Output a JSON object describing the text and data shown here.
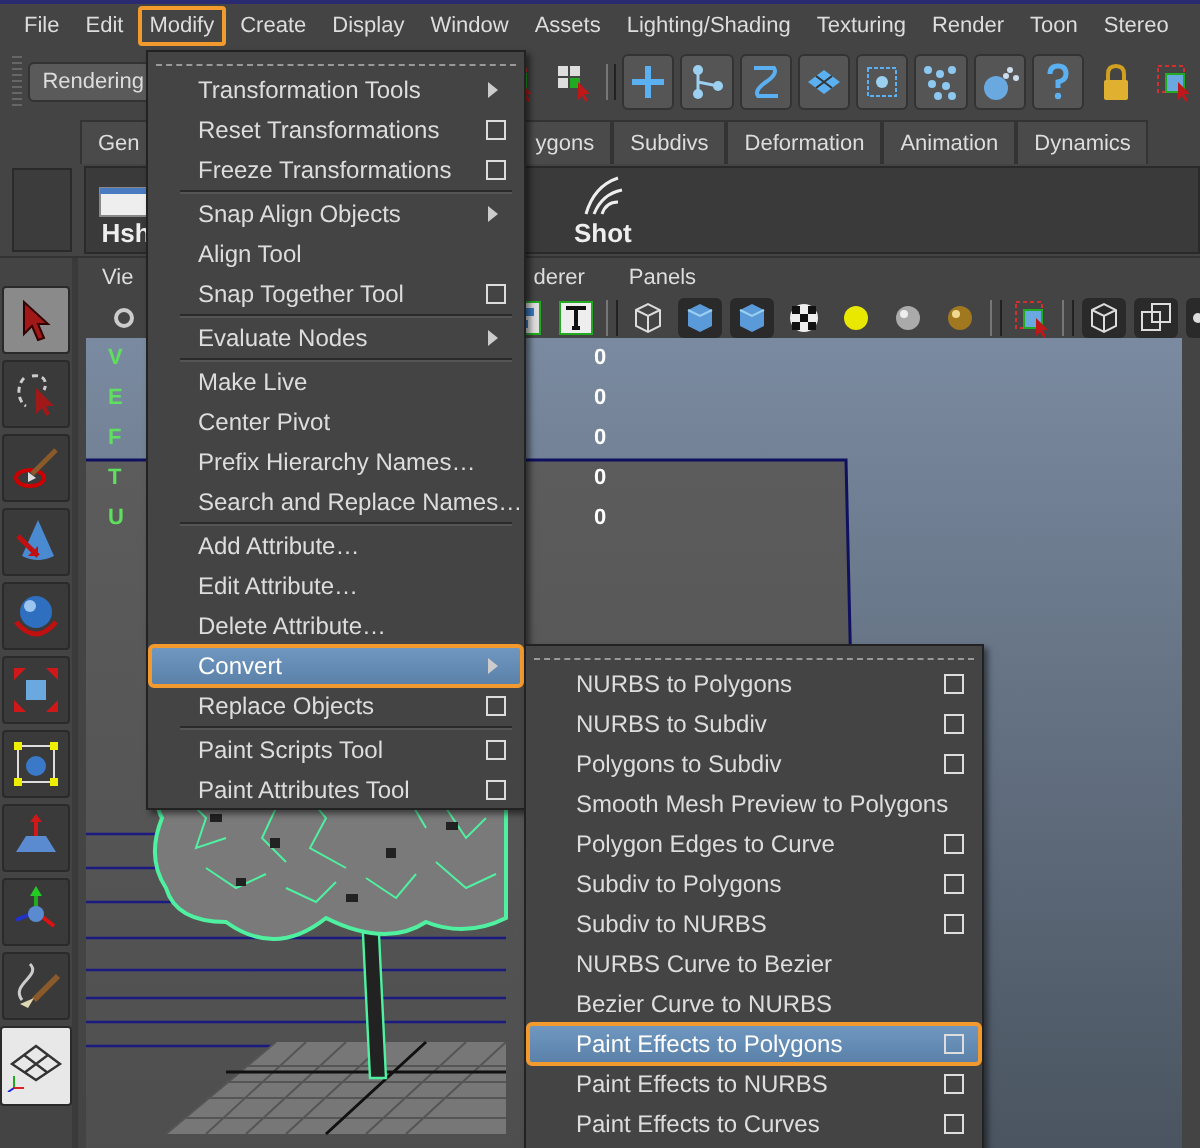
{
  "menubar": [
    {
      "label": "File",
      "selected": false
    },
    {
      "label": "Edit",
      "selected": false
    },
    {
      "label": "Modify",
      "selected": true
    },
    {
      "label": "Create",
      "selected": false
    },
    {
      "label": "Display",
      "selected": false
    },
    {
      "label": "Window",
      "selected": false
    },
    {
      "label": "Assets",
      "selected": false
    },
    {
      "label": "Lighting/Shading",
      "selected": false
    },
    {
      "label": "Texturing",
      "selected": false
    },
    {
      "label": "Render",
      "selected": false
    },
    {
      "label": "Toon",
      "selected": false
    },
    {
      "label": "Stereo",
      "selected": false
    }
  ],
  "toolbar": {
    "menu_set": "Rendering"
  },
  "shelf_tabs": [
    {
      "label": "Gen"
    },
    {
      "label": "ygons"
    },
    {
      "label": "Subdivs"
    },
    {
      "label": "Deformation"
    },
    {
      "label": "Animation"
    },
    {
      "label": "Dynamics"
    }
  ],
  "shelf_buttons": [
    {
      "label": "Hsh"
    },
    {
      "label": "Shot"
    }
  ],
  "viewport": {
    "menus": [
      "Vie",
      "derer",
      "Panels"
    ],
    "hud": [
      {
        "label": "V",
        "value": "0"
      },
      {
        "label": "E",
        "value": "0"
      },
      {
        "label": "F",
        "value": "0"
      },
      {
        "label": "T",
        "value": "0"
      },
      {
        "label": "U",
        "value": "0"
      }
    ]
  },
  "modify_menu": {
    "items": [
      {
        "label": "Transformation Tools",
        "kind": "submenu",
        "selected": false
      },
      {
        "label": "Reset Transformations",
        "kind": "option",
        "selected": false
      },
      {
        "label": "Freeze Transformations",
        "kind": "option",
        "selected": false
      },
      {
        "kind": "separator"
      },
      {
        "label": "Snap Align Objects",
        "kind": "submenu",
        "selected": false
      },
      {
        "label": "Align Tool",
        "kind": "plain",
        "selected": false
      },
      {
        "label": "Snap Together Tool",
        "kind": "option",
        "selected": false
      },
      {
        "kind": "separator"
      },
      {
        "label": "Evaluate Nodes",
        "kind": "submenu",
        "selected": false
      },
      {
        "kind": "separator"
      },
      {
        "label": "Make Live",
        "kind": "plain",
        "selected": false
      },
      {
        "label": "Center Pivot",
        "kind": "plain",
        "selected": false
      },
      {
        "label": "Prefix Hierarchy Names…",
        "kind": "plain",
        "selected": false
      },
      {
        "label": "Search and Replace Names…",
        "kind": "plain",
        "selected": false
      },
      {
        "kind": "separator"
      },
      {
        "label": "Add Attribute…",
        "kind": "plain",
        "selected": false
      },
      {
        "label": "Edit Attribute…",
        "kind": "plain",
        "selected": false
      },
      {
        "label": "Delete Attribute…",
        "kind": "plain",
        "selected": false
      },
      {
        "label": "Convert",
        "kind": "submenu",
        "selected": true
      },
      {
        "label": "Replace Objects",
        "kind": "option",
        "selected": false
      },
      {
        "kind": "separator"
      },
      {
        "label": "Paint Scripts Tool",
        "kind": "option",
        "selected": false
      },
      {
        "label": "Paint Attributes Tool",
        "kind": "option",
        "selected": false
      }
    ]
  },
  "convert_submenu": {
    "items": [
      {
        "label": "NURBS to Polygons",
        "kind": "option",
        "selected": false
      },
      {
        "label": "NURBS to Subdiv",
        "kind": "option",
        "selected": false
      },
      {
        "label": "Polygons to Subdiv",
        "kind": "option",
        "selected": false
      },
      {
        "label": "Smooth Mesh Preview to Polygons",
        "kind": "plain",
        "selected": false
      },
      {
        "label": "Polygon Edges to Curve",
        "kind": "option",
        "selected": false
      },
      {
        "label": "Subdiv to Polygons",
        "kind": "option",
        "selected": false
      },
      {
        "label": "Subdiv to NURBS",
        "kind": "option",
        "selected": false
      },
      {
        "label": "NURBS Curve to Bezier",
        "kind": "plain",
        "selected": false
      },
      {
        "label": "Bezier Curve to NURBS",
        "kind": "plain",
        "selected": false
      },
      {
        "label": "Paint Effects to Polygons",
        "kind": "option",
        "selected": true
      },
      {
        "label": "Paint Effects to NURBS",
        "kind": "option",
        "selected": false
      },
      {
        "label": "Paint Effects to Curves",
        "kind": "option",
        "selected": false
      }
    ]
  }
}
